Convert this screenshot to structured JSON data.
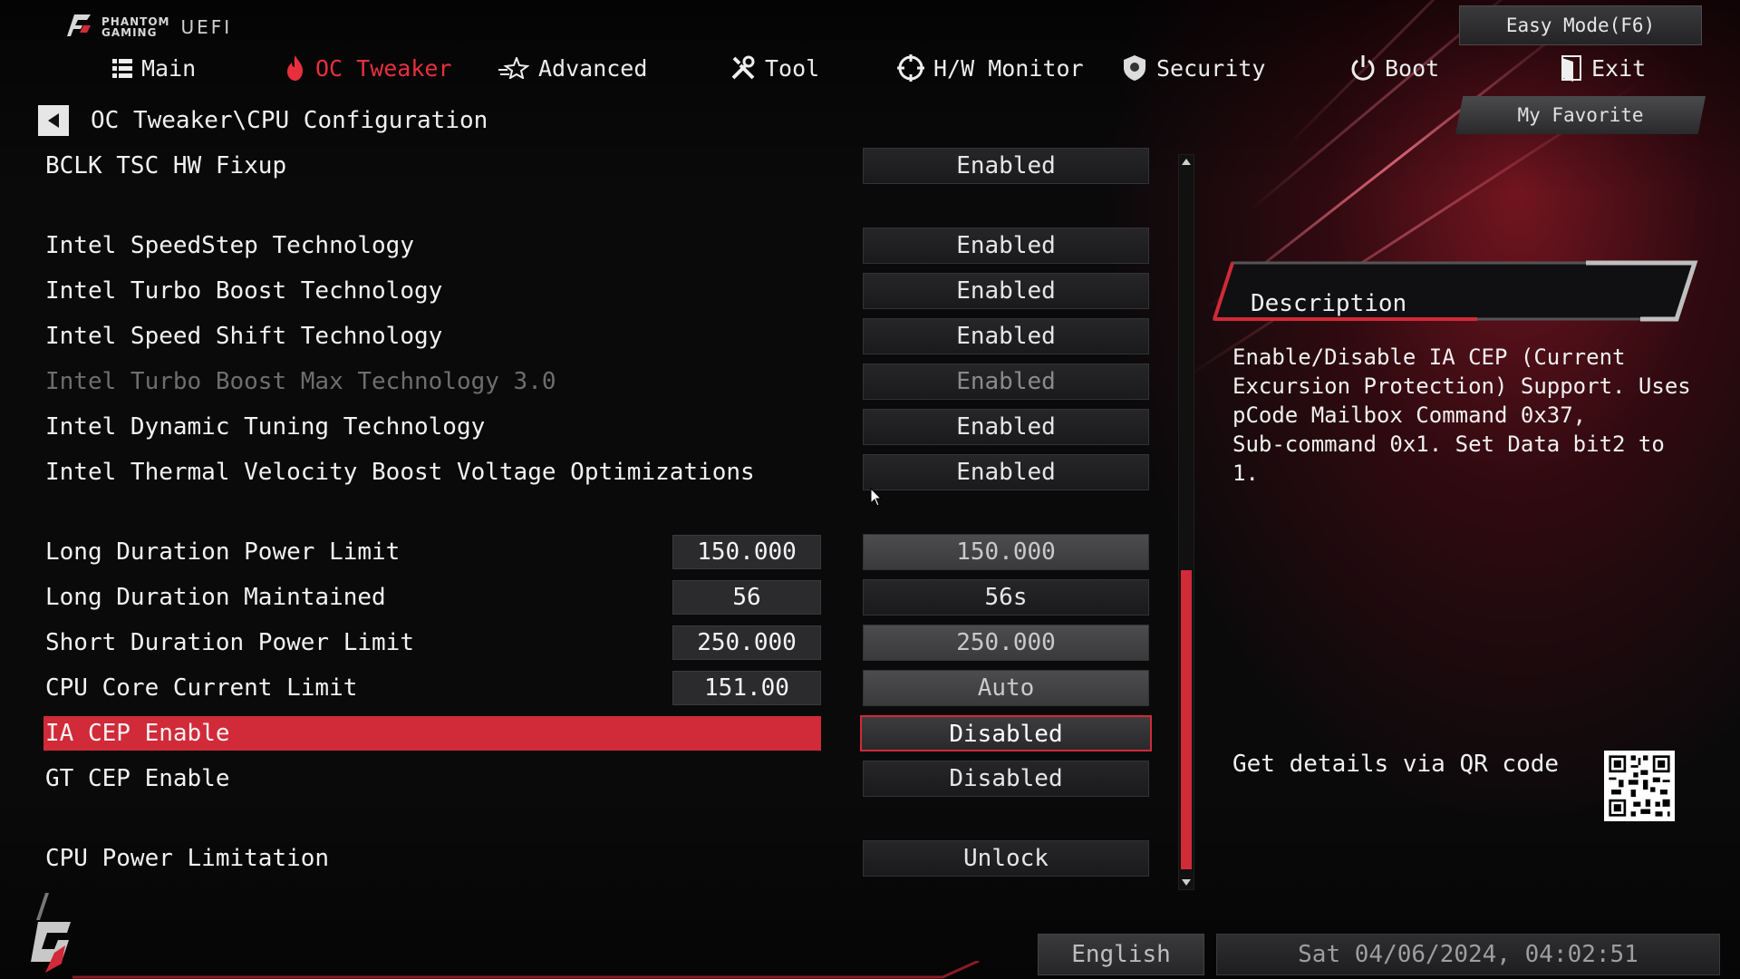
{
  "header": {
    "brand": "PHANTOM\nGAMING",
    "brand_line1": "PHANTOM",
    "brand_line2": "GAMING",
    "product": "UEFI",
    "easy_mode": "Easy Mode(F6)",
    "my_favorite": "My Favorite"
  },
  "nav": {
    "tabs": [
      {
        "label": "Main",
        "icon": "list-icon"
      },
      {
        "label": "OC Tweaker",
        "icon": "flame-icon",
        "active": true
      },
      {
        "label": "Advanced",
        "icon": "star-icon"
      },
      {
        "label": "Tool",
        "icon": "tools-icon"
      },
      {
        "label": "H/W Monitor",
        "icon": "monitor-gauge-icon"
      },
      {
        "label": "Security",
        "icon": "shield-icon"
      },
      {
        "label": "Boot",
        "icon": "power-icon"
      },
      {
        "label": "Exit",
        "icon": "exit-door-icon"
      }
    ]
  },
  "breadcrumb": "OC Tweaker\\CPU Configuration",
  "settings": [
    {
      "label": "BCLK TSC HW Fixup",
      "value": "Enabled"
    },
    {
      "label": "Intel SpeedStep Technology",
      "value": "Enabled"
    },
    {
      "label": "Intel Turbo Boost Technology",
      "value": "Enabled"
    },
    {
      "label": "Intel Speed Shift Technology",
      "value": "Enabled"
    },
    {
      "label": "Intel Turbo Boost Max Technology 3.0",
      "value": "Enabled",
      "disabled": true
    },
    {
      "label": "Intel Dynamic Tuning Technology",
      "value": "Enabled"
    },
    {
      "label": "Intel Thermal Velocity Boost Voltage Optimizations",
      "value": "Enabled"
    },
    {
      "label": "Long Duration Power Limit",
      "current": "150.000",
      "value": "150.000"
    },
    {
      "label": "Long Duration Maintained",
      "current": "56",
      "value": "56s"
    },
    {
      "label": "Short Duration Power Limit",
      "current": "250.000",
      "value": "250.000"
    },
    {
      "label": "CPU Core Current Limit",
      "current": "151.00",
      "value": "Auto"
    },
    {
      "label": "IA CEP Enable",
      "value": "Disabled",
      "selected": true
    },
    {
      "label": "GT CEP Enable",
      "value": "Disabled"
    },
    {
      "label": "CPU Power Limitation",
      "value": "Unlock"
    }
  ],
  "description": {
    "title": "Description",
    "text": "Enable/Disable IA CEP (Current\nExcursion Protection) Support. Uses\npCode Mailbox Command 0x37,\nSub-command 0x1. Set Data bit2 to 1.",
    "qr_label": "Get details via QR code"
  },
  "footer": {
    "language": "English",
    "datetime": "Sat 04/06/2024, 04:02:51"
  },
  "colors": {
    "accent": "#d12a38",
    "active_tab": "#e8303d",
    "background": "#0a0a0b"
  }
}
